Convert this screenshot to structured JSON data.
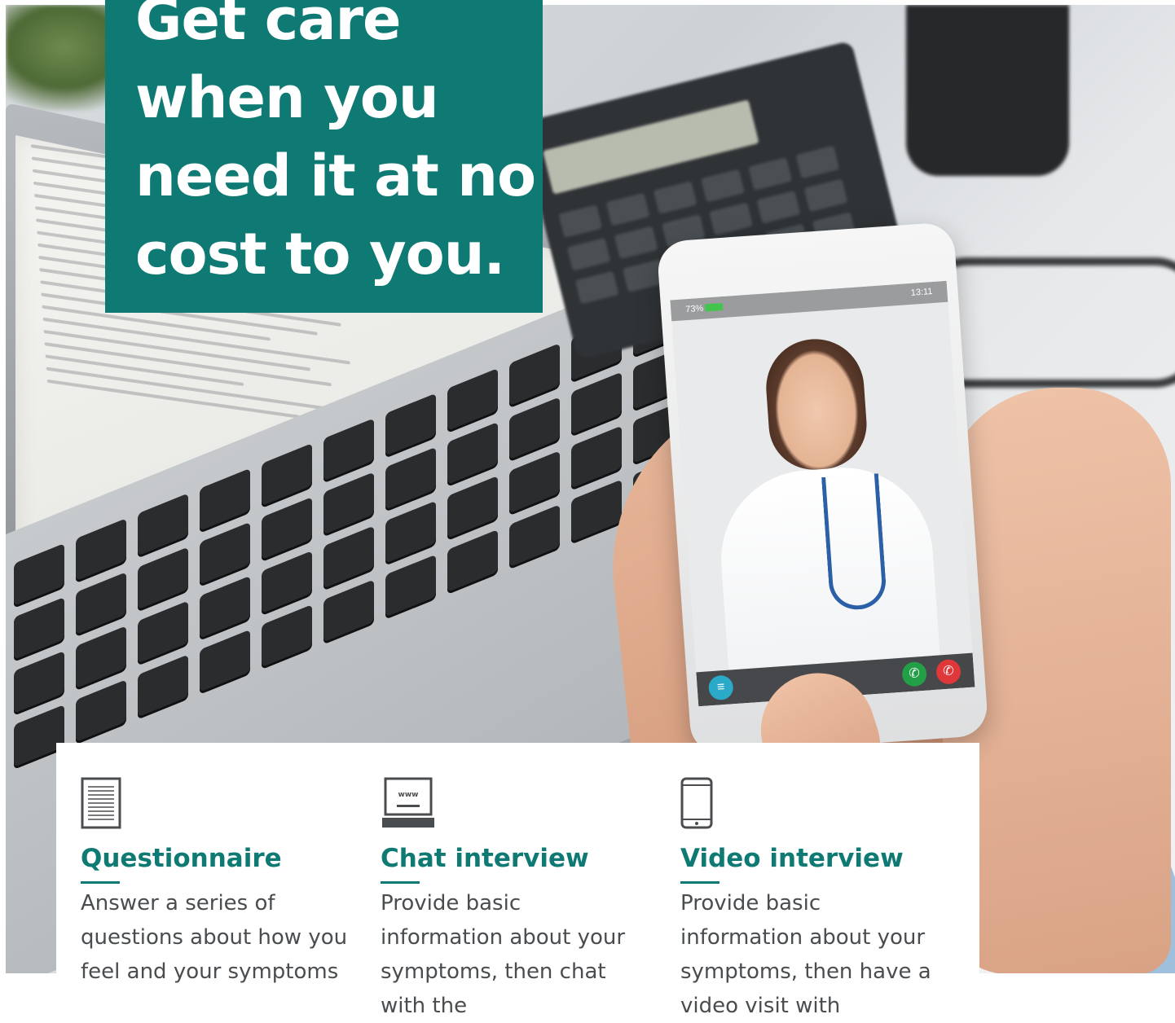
{
  "hero": {
    "headline": "Get care when you need it at no cost to you.",
    "phone": {
      "battery_text": "73%",
      "clock": "13:11"
    }
  },
  "colors": {
    "brand_teal": "#0e7a73",
    "body_text": "#4a4d50"
  },
  "features": [
    {
      "icon": "document-icon",
      "title": "Questionnaire",
      "description": "Answer a series of questions about how you feel and your symptoms"
    },
    {
      "icon": "laptop-icon",
      "icon_text": "www",
      "title": "Chat interview",
      "description": "Provide basic information about your symptoms, then chat with the"
    },
    {
      "icon": "smartphone-icon",
      "title": "Video interview",
      "description": "Provide basic information about your symptoms, then have a video visit with"
    }
  ]
}
